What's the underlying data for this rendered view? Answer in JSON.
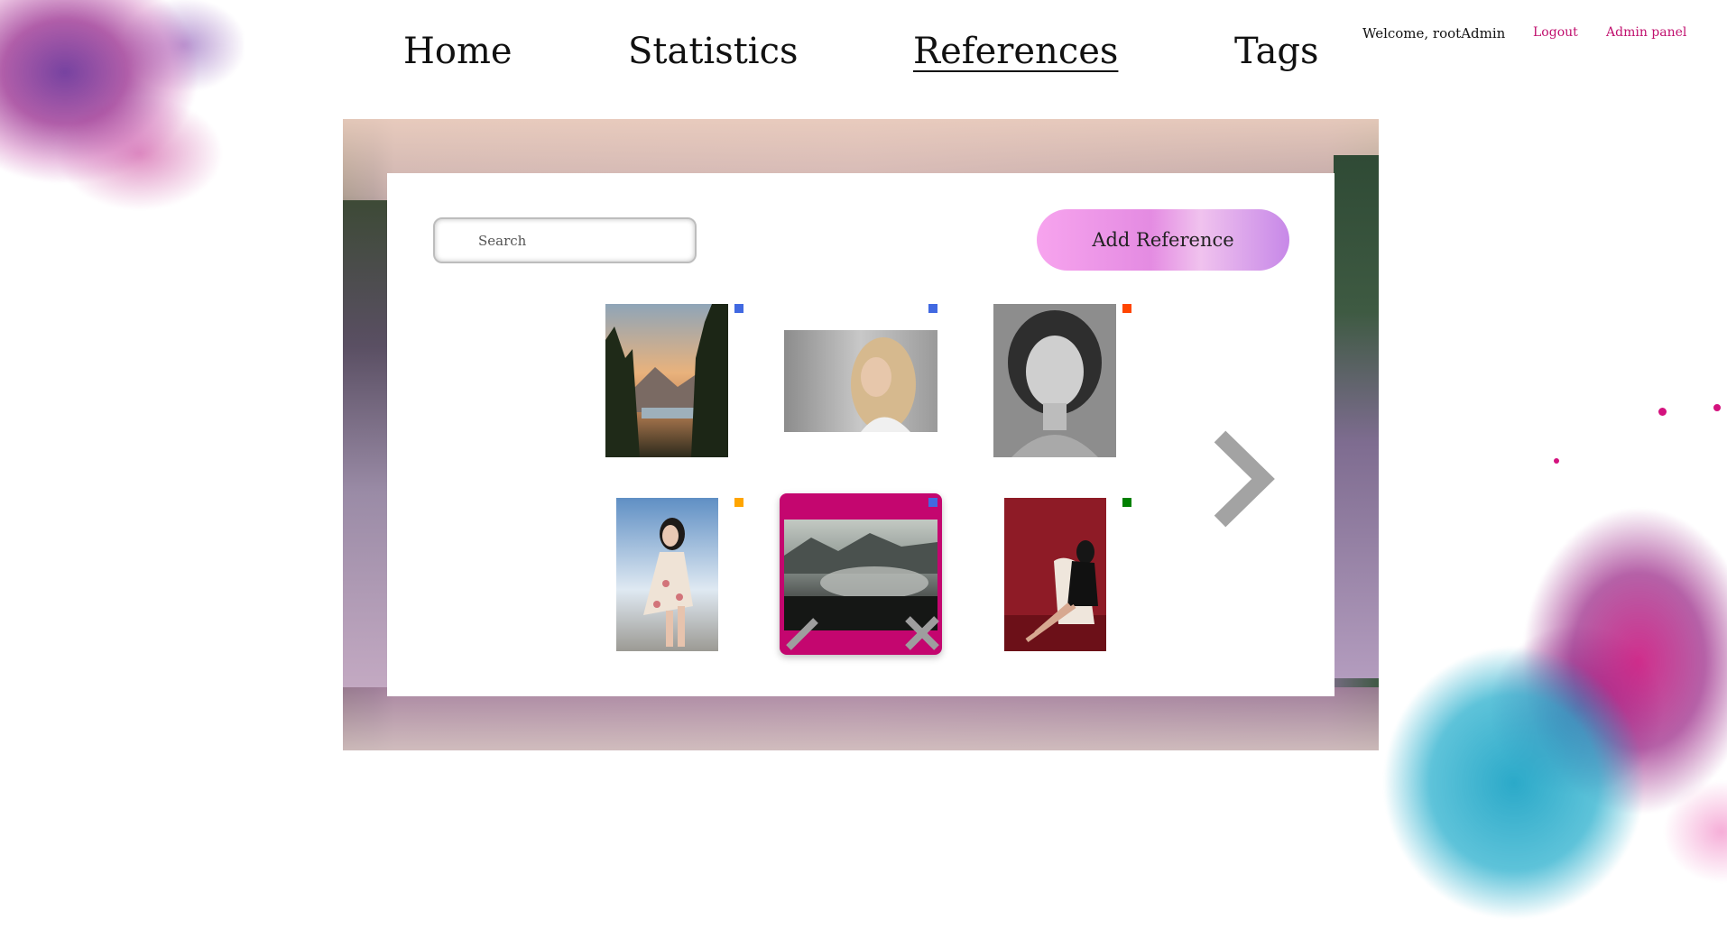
{
  "nav": {
    "items": [
      {
        "label": "Home",
        "active": false
      },
      {
        "label": "Statistics",
        "active": false
      },
      {
        "label": "References",
        "active": true
      },
      {
        "label": "Tags",
        "active": false
      }
    ]
  },
  "user": {
    "welcome": "Welcome, rootAdmin",
    "logout": "Logout",
    "admin_panel": "Admin panel"
  },
  "toolbar": {
    "search_placeholder": "Search",
    "add_label": "Add Reference"
  },
  "colors": {
    "accent": "#c4066f",
    "link": "#c0106e",
    "tag_blue": "#4169e1",
    "tag_red": "#ff4500",
    "tag_orange": "#ffa500",
    "tag_green": "#008000"
  },
  "references": [
    {
      "subject": "pine forest at sunset over mountain lake",
      "tag_color": "#4169e1",
      "selected": false
    },
    {
      "subject": "blonde woman portrait",
      "tag_color": "#4169e1",
      "selected": false
    },
    {
      "subject": "black and white woman portrait",
      "tag_color": "#ff4500",
      "selected": false
    },
    {
      "subject": "woman in floral dress by the sea",
      "tag_color": "#ffa500",
      "selected": false
    },
    {
      "subject": "misty forest and mountains",
      "tag_color": "#4169e1",
      "selected": true
    },
    {
      "subject": "woman sitting on chair against red wall",
      "tag_color": "#008000",
      "selected": false
    }
  ],
  "icons": {
    "edit": "pencil-icon",
    "delete": "close-icon",
    "next": "chevron-right-icon"
  }
}
